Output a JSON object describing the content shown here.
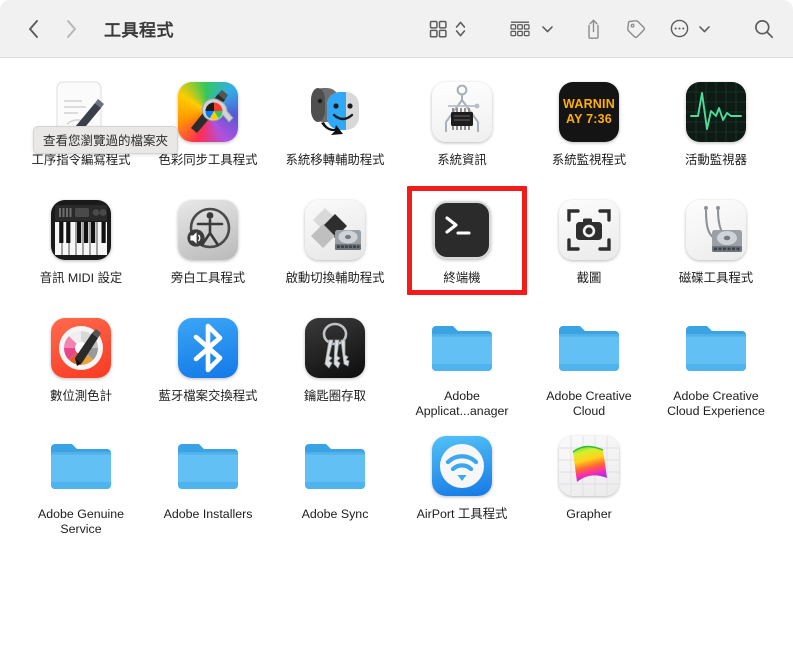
{
  "window": {
    "title": "工具程式"
  },
  "toolbar": {
    "back_label": "‹",
    "forward_label": "›",
    "icons": [
      {
        "name": "view-grid-icon",
        "label": "圖像顯示方式"
      },
      {
        "name": "view-stepper-icon",
        "label": "顯示方式切換"
      },
      {
        "name": "group-by-icon",
        "label": "群組方式"
      },
      {
        "name": "group-chevron-icon",
        "label": "群組方式選單"
      },
      {
        "name": "share-icon",
        "label": "分享"
      },
      {
        "name": "tag-icon",
        "label": "標記"
      },
      {
        "name": "more-actions-icon",
        "label": "更多"
      },
      {
        "name": "more-chevron-icon",
        "label": "更多選單"
      },
      {
        "name": "search-icon",
        "label": "搜尋"
      }
    ]
  },
  "tooltip": {
    "visible": true,
    "text": "查看您瀏覽過的檔案夾"
  },
  "selection": {
    "selected_item": "終端機",
    "highlight_color": "#f41b1b"
  },
  "items": [
    {
      "label": "工序指令編寫程式",
      "icon": "script-editor-icon",
      "type": "app",
      "selected": false
    },
    {
      "label": "色彩同步工具程式",
      "icon": "colorsync-utility-icon",
      "type": "app",
      "selected": false
    },
    {
      "label": "系統移轉輔助程式",
      "icon": "migration-assistant-icon",
      "type": "app",
      "selected": false
    },
    {
      "label": "系統資訊",
      "icon": "system-information-icon",
      "type": "app",
      "selected": false
    },
    {
      "label": "系統監視程式",
      "icon": "system-monitor-icon",
      "type": "app",
      "selected": false
    },
    {
      "label": "活動監視器",
      "icon": "activity-monitor-icon",
      "type": "app",
      "selected": false
    },
    {
      "label": "音訊 MIDI 設定",
      "icon": "audio-midi-setup-icon",
      "type": "app",
      "selected": false
    },
    {
      "label": "旁白工具程式",
      "icon": "voiceover-utility-icon",
      "type": "app",
      "selected": false
    },
    {
      "label": "啟動切換輔助程式",
      "icon": "boot-camp-assistant-icon",
      "type": "app",
      "selected": false
    },
    {
      "label": "終端機",
      "icon": "terminal-icon",
      "type": "app",
      "selected": true
    },
    {
      "label": "截圖",
      "icon": "screenshot-icon",
      "type": "app",
      "selected": false
    },
    {
      "label": "磁碟工具程式",
      "icon": "disk-utility-icon",
      "type": "app",
      "selected": false
    },
    {
      "label": "數位測色計",
      "icon": "digital-color-meter-icon",
      "type": "app",
      "selected": false
    },
    {
      "label": "藍牙檔案交換程式",
      "icon": "bluetooth-file-exchange-icon",
      "type": "app",
      "selected": false
    },
    {
      "label": "鑰匙圈存取",
      "icon": "keychain-access-icon",
      "type": "app",
      "selected": false
    },
    {
      "label": "Adobe Applicat...anager",
      "icon": "folder-icon",
      "type": "folder",
      "selected": false
    },
    {
      "label": "Adobe Creative Cloud",
      "icon": "folder-icon",
      "type": "folder",
      "selected": false
    },
    {
      "label": "Adobe Creative Cloud Experience",
      "icon": "folder-icon",
      "type": "folder",
      "selected": false
    },
    {
      "label": "Adobe Genuine Service",
      "icon": "folder-icon",
      "type": "folder",
      "selected": false
    },
    {
      "label": "Adobe Installers",
      "icon": "folder-icon",
      "type": "folder",
      "selected": false
    },
    {
      "label": "Adobe Sync",
      "icon": "folder-icon",
      "type": "folder",
      "selected": false
    },
    {
      "label": "AirPort 工具程式",
      "icon": "airport-utility-icon",
      "type": "app",
      "selected": false
    },
    {
      "label": "Grapher",
      "icon": "grapher-icon",
      "type": "app",
      "selected": false
    }
  ],
  "watch_icon": {
    "line1": "WARNIN",
    "line2": "AY 7:36"
  }
}
